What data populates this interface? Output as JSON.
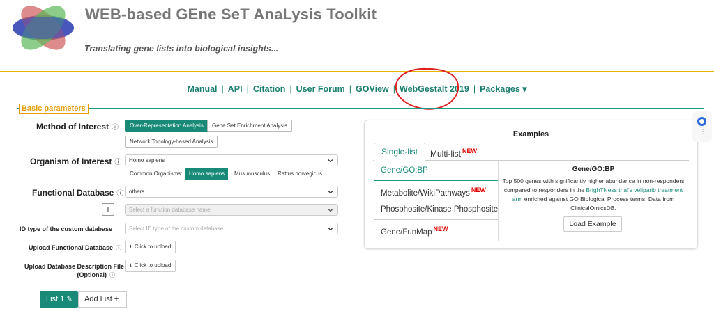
{
  "header": {
    "title": "WEB-based GEne SeT AnaLysis Toolkit",
    "subtitle": "Translating gene lists into biological insights..."
  },
  "nav": {
    "items": [
      "Manual",
      "API",
      "Citation",
      "User Forum",
      "GOView",
      "WebGestalt 2019",
      "Packages ▾"
    ],
    "separator": "|"
  },
  "basic_parameters": {
    "legend": "Basic parameters",
    "method": {
      "label": "Method of Interest",
      "options": [
        "Over-Representation Analysis",
        "Gene Set Enrichment Analysis",
        "Network Topology-based Analysis"
      ],
      "selected": "Over-Representation Analysis"
    },
    "organism": {
      "label": "Organism of Interest",
      "value": "Homo sapiens",
      "common_label": "Common Organisms:",
      "common": [
        "Homo sapiens",
        "Mus musculus",
        "Rattus norvegicus"
      ],
      "common_selected": "Homo sapiens"
    },
    "functional_database": {
      "label": "Functional Database",
      "value": "others",
      "name_placeholder": "Select a function database name",
      "add_label": "+"
    },
    "custom_id_type": {
      "label": "ID type of the custom database",
      "placeholder": "Select ID type of the custom database"
    },
    "upload_db": {
      "label": "Upload Functional Database",
      "button": "Click to upload"
    },
    "upload_desc": {
      "label": "Upload Database Description File",
      "label2": "(Optional)",
      "button": "Click to upload"
    },
    "lists": {
      "current": "List 1",
      "add": "Add List +"
    }
  },
  "examples": {
    "title": "Examples",
    "tabs": [
      "Single-list",
      "Multi-list"
    ],
    "tab_new": "NEW",
    "items": [
      {
        "label": "Gene/GO:BP",
        "new": ""
      },
      {
        "label": "Metabolite/WikiPathways",
        "new": "NEW"
      },
      {
        "label": "Phosphosite/Kinase Phosphosite",
        "new": ""
      },
      {
        "label": "Gene/FunMap",
        "new": "NEW"
      }
    ],
    "detail": {
      "title": "Gene/GO:BP",
      "desc_pre": "Top 500 genes with significantly higher abundance in non-responders compared to responders in the ",
      "desc_link": "BrighTNess trial's veliparib treatment arm",
      "desc_post": " enriched against GO Biological Process terms. Data from ClinicalOmicsDB.",
      "button": "Load Example"
    }
  },
  "colors": {
    "accent": "#1a8a78",
    "header_rule": "#e6b400",
    "legend": "#e69c00",
    "new_badge": "#dd0000",
    "annotation_circle": "#e02020"
  },
  "icons": {
    "help": "question-circle-icon",
    "upload": "upload-icon",
    "edit": "pencil-icon",
    "dropdown": "chevron-down-icon"
  }
}
